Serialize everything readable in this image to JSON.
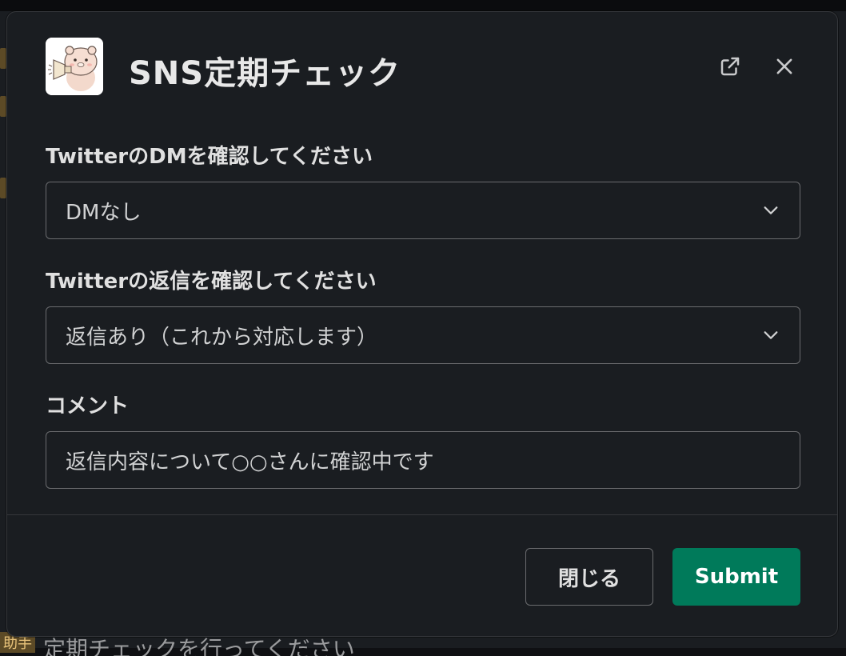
{
  "background": {
    "bottom_badge": "助手",
    "bottom_message": "定期チェックを行ってください"
  },
  "modal": {
    "title": "SNS定期チェック",
    "app_icon": "bear-megaphone-avatar",
    "icons": {
      "popout": "external-link-icon",
      "close": "close-icon"
    },
    "fields": [
      {
        "label": "TwitterのDMを確認してください",
        "value": "DMなし",
        "type": "select"
      },
      {
        "label": "Twitterの返信を確認してください",
        "value": "返信あり（これから対応します）",
        "type": "select"
      },
      {
        "label": "コメント",
        "value": "返信内容について○○さんに確認中です",
        "type": "text"
      }
    ],
    "buttons": {
      "close": "閉じる",
      "submit": "Submit"
    },
    "colors": {
      "submit_bg": "#007a5a",
      "modal_bg": "#1a1d21",
      "border": "#6a6b6e"
    }
  }
}
